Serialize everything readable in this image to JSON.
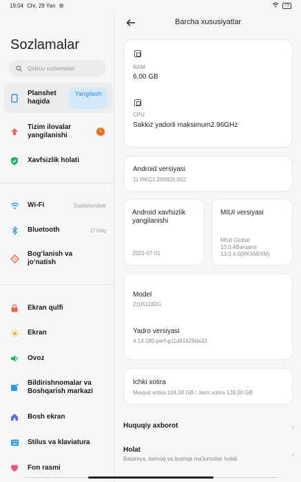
{
  "status": {
    "time": "19:04",
    "date": "Chr, 29 Yan",
    "battery": "71"
  },
  "left": {
    "title": "Sozlamalar",
    "search_placeholder": "Qidiruv sozlamalari",
    "items": [
      {
        "label": "Planshet haqida",
        "pill": "Yangilash"
      },
      {
        "label": "Tizim ilovalar yangilanishi",
        "badge": "1"
      },
      {
        "label": "Xavfsizlik holati"
      },
      {
        "label": "Wi-Fi",
        "value": "Saidislombek"
      },
      {
        "label": "Bluetooth",
        "value": "O‘chiq"
      },
      {
        "label": "Bog‘lanish va jo‘natish"
      },
      {
        "label": "Ekran qulfi"
      },
      {
        "label": "Ekran"
      },
      {
        "label": "Ovoz"
      },
      {
        "label": "Bildirishnomalar va Boshqarish markazi"
      },
      {
        "label": "Bosh ekran"
      },
      {
        "label": "Stilus va klaviatura"
      },
      {
        "label": "Fon rasmi"
      }
    ]
  },
  "right": {
    "title": "Barcha xususiyatlar",
    "ram_label": "RAM",
    "ram_value": "6,00 GB",
    "cpu_label": "CPU",
    "cpu_value": "Sakkiz yadorli maksimum2.96GHz",
    "android_version_title": "Android versiyasi",
    "android_version_value": "11 RKQ1.200826.002",
    "security_title": "Android xavfsizlik yangilanishi",
    "security_value": "2022-07-01",
    "miui_title": "MIUI versiyasi",
    "miui_value": "MIUI Global 13.0.4Barqaror 13.0.4.0(RKXMIXM)",
    "model_title": "Model",
    "model_value": "21051182G",
    "kernel_title": "Yadro versiyasi",
    "kernel_value": "4.14.180-perf-g11d81629da33",
    "storage_title": "Ichki xotira",
    "storage_value": "Mavjud xotira  104,00 GB / Jami xotira  128,00 GB",
    "legal_title": "Huquqiy axborot",
    "status_title": "Holat",
    "status_sub": "Batareya, tarmoq va boshqa ma’lumotlar holati"
  },
  "colors": {
    "accent": "#2a8fe0",
    "badge": "#f26a1a"
  }
}
